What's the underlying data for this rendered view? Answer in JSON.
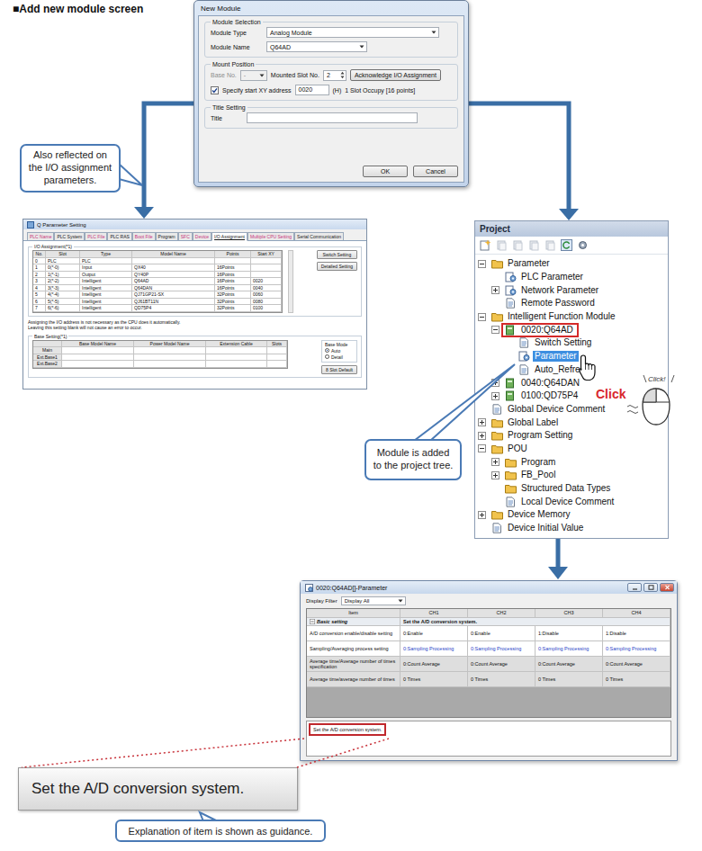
{
  "heading": "■Add new module screen",
  "new_module": {
    "title": "New Module",
    "module_selection": {
      "legend": "Module Selection",
      "fields": [
        {
          "label": "Module Type",
          "value": "Analog Module"
        },
        {
          "label": "Module Name",
          "value": "Q64AD"
        }
      ]
    },
    "mount_position": {
      "legend": "Mount Position",
      "base_no": {
        "label": "Base No.",
        "value": "-",
        "disabled": true
      },
      "slot": {
        "label": "Mounted Slot No.",
        "value": "2"
      },
      "ack_button": "Acknowledge I/O Assignment",
      "start_xy": {
        "label": "Specify start XY address",
        "checked": true,
        "value": "0020",
        "unit": "(H)",
        "occupy": "1 Slot Occupy [16 points]"
      }
    },
    "title_setting": {
      "legend": "Title Setting",
      "label": "Title",
      "value": ""
    },
    "buttons": [
      "OK",
      "Cancel"
    ]
  },
  "callouts": {
    "io": "Also reflected on the I/O assignment parameters.",
    "tree": "Module is added to the project tree.",
    "guidance": "Explanation of item is shown as guidance."
  },
  "param_setting": {
    "title": "Q Parameter Setting",
    "tabs": [
      {
        "label": "PLC Name",
        "selected": false,
        "color": "#c8357c"
      },
      {
        "label": "PLC System",
        "selected": false,
        "color": "#1a1a1a"
      },
      {
        "label": "PLC File",
        "selected": false,
        "color": "#c8357c"
      },
      {
        "label": "PLC RAS",
        "selected": false,
        "color": "#1a1a1a"
      },
      {
        "label": "Boot File",
        "selected": false,
        "color": "#c8357c"
      },
      {
        "label": "Program",
        "selected": false,
        "color": "#1a1a1a"
      },
      {
        "label": "SFC",
        "selected": false,
        "color": "#c8357c"
      },
      {
        "label": "Device",
        "selected": false,
        "color": "#c8357c"
      },
      {
        "label": "I/O Assignment",
        "selected": true,
        "color": "#1a1a1a"
      },
      {
        "label": "Multiple CPU Setting",
        "selected": false,
        "color": "#c8357c"
      },
      {
        "label": "Serial Communication",
        "selected": false,
        "color": "#1a1a1a"
      }
    ],
    "io_group": "I/O Assignment(*1)",
    "io_columns": [
      "No.",
      "Slot",
      "Type",
      "Model Name",
      "Points",
      "Start XY"
    ],
    "io_rows": [
      [
        "0",
        "PLC",
        "PLC",
        "",
        "",
        ""
      ],
      [
        "1",
        "0(*-0)",
        "Input",
        "QX40",
        "16Points",
        ""
      ],
      [
        "2",
        "1(*-1)",
        "Output",
        "QY40P",
        "16Points",
        ""
      ],
      [
        "3",
        "2(*-2)",
        "Intelligent",
        "Q64AD",
        "16Points",
        "0020"
      ],
      [
        "4",
        "3(*-3)",
        "Intelligent",
        "Q64DAN",
        "16Points",
        "0040"
      ],
      [
        "5",
        "4(*-4)",
        "Intelligent",
        "QJ71GP21-SX",
        "32Points",
        "0060"
      ],
      [
        "6",
        "5(*-5)",
        "Intelligent",
        "QJ61BT11N",
        "32Points",
        "0080"
      ],
      [
        "7",
        "6(*-6)",
        "Intelligent",
        "QD75P4",
        "32Points",
        "0100"
      ]
    ],
    "side_buttons": [
      "Switch Setting",
      "Detailed Setting"
    ],
    "notes": [
      "Assigning the I/O address is not necessary as the CPU does it automatically.",
      "Leaving this setting blank will not cause an error to occur."
    ],
    "base_group": "Base Setting(*1)",
    "base_columns": [
      "",
      "Base Model Name",
      "Power Model Name",
      "Extension Cable",
      "Slots"
    ],
    "base_rows": [
      "Main",
      "Ext.Base1",
      "Ext.Base2"
    ],
    "base_mode": {
      "label": "Base Mode",
      "options": [
        {
          "label": "Auto",
          "selected": true
        },
        {
          "label": "Detail",
          "selected": false
        }
      ]
    },
    "default_button": "8 Slot Default"
  },
  "project": {
    "title": "Project",
    "click_label": "Click",
    "mouse_label": "Click!",
    "tree": [
      {
        "label": "Parameter",
        "kind": "folder",
        "has_children": true,
        "expanded": true,
        "selected": false,
        "boxed": false,
        "children": [
          {
            "label": "PLC Parameter",
            "kind": "param",
            "has_children": false,
            "expanded": false,
            "selected": false,
            "boxed": false,
            "children": []
          },
          {
            "label": "Network Parameter",
            "kind": "param",
            "has_children": true,
            "expanded": false,
            "selected": false,
            "boxed": false,
            "children": []
          },
          {
            "label": "Remote Password",
            "kind": "doc",
            "has_children": false,
            "expanded": false,
            "selected": false,
            "boxed": false,
            "children": []
          }
        ]
      },
      {
        "label": "Intelligent Function Module",
        "kind": "folder",
        "has_children": true,
        "expanded": true,
        "selected": false,
        "boxed": false,
        "children": [
          {
            "label": "0020:Q64AD",
            "kind": "module",
            "has_children": true,
            "expanded": true,
            "selected": false,
            "boxed": true,
            "children": [
              {
                "label": "Switch Setting",
                "kind": "doc",
                "has_children": false,
                "expanded": false,
                "selected": false,
                "boxed": false,
                "children": []
              },
              {
                "label": "Parameter",
                "kind": "param",
                "has_children": false,
                "expanded": false,
                "selected": true,
                "boxed": false,
                "children": []
              },
              {
                "label": "Auto_Refre",
                "kind": "doc",
                "has_children": false,
                "expanded": false,
                "selected": false,
                "boxed": false,
                "children": []
              }
            ]
          },
          {
            "label": "0040:Q64DAN",
            "kind": "module",
            "has_children": true,
            "expanded": false,
            "selected": false,
            "boxed": false,
            "children": []
          },
          {
            "label": "0100:QD75P4",
            "kind": "module",
            "has_children": true,
            "expanded": false,
            "selected": false,
            "boxed": false,
            "children": []
          }
        ]
      },
      {
        "label": "Global Device Comment",
        "kind": "doc",
        "has_children": false,
        "expanded": false,
        "selected": false,
        "boxed": false,
        "children": []
      },
      {
        "label": "Global Label",
        "kind": "folder",
        "has_children": true,
        "expanded": false,
        "selected": false,
        "boxed": false,
        "children": []
      },
      {
        "label": "Program Setting",
        "kind": "folder",
        "has_children": true,
        "expanded": false,
        "selected": false,
        "boxed": false,
        "children": []
      },
      {
        "label": "POU",
        "kind": "folder",
        "has_children": true,
        "expanded": true,
        "selected": false,
        "boxed": false,
        "children": [
          {
            "label": "Program",
            "kind": "folder",
            "has_children": true,
            "expanded": false,
            "selected": false,
            "boxed": false,
            "children": []
          },
          {
            "label": "FB_Pool",
            "kind": "folder",
            "has_children": true,
            "expanded": false,
            "selected": false,
            "boxed": false,
            "children": []
          },
          {
            "label": "Structured Data Types",
            "kind": "folder",
            "has_children": false,
            "expanded": false,
            "selected": false,
            "boxed": false,
            "children": []
          },
          {
            "label": "Local Device Comment",
            "kind": "doc",
            "has_children": false,
            "expanded": false,
            "selected": false,
            "boxed": false,
            "children": []
          }
        ]
      },
      {
        "label": "Device Memory",
        "kind": "folder",
        "has_children": true,
        "expanded": false,
        "selected": false,
        "boxed": false,
        "children": []
      },
      {
        "label": "Device Initial Value",
        "kind": "doc",
        "has_children": false,
        "expanded": false,
        "selected": false,
        "boxed": false,
        "children": []
      }
    ]
  },
  "ad_parameter": {
    "title": "0020:Q64AD[]-Parameter",
    "filter": {
      "label": "Display Filter",
      "value": "Display All"
    },
    "columns": [
      "Item",
      "CH1",
      "CH2",
      "CH3",
      "CH4"
    ],
    "group": {
      "label": "Basic setting",
      "description": "Set the A/D conversion system.",
      "expanded": true
    },
    "rows": [
      {
        "item": "A/D conversion enable/disable setting",
        "values": [
          "0:Enable",
          "0:Enable",
          "1:Disable",
          "1:Disable"
        ],
        "color": "#111111",
        "disabled": false
      },
      {
        "item": "Sampling/Averaging process setting",
        "values": [
          "0:Sampling Processing",
          "0:Sampling Processing",
          "0:Sampling Processing",
          "0:Sampling Processing"
        ],
        "color": "#1f45c8",
        "disabled": false
      },
      {
        "item": "Average time/Average number of times specification",
        "values": [
          "0:Count Average",
          "0:Count Average",
          "0:Count Average",
          "0:Count Average"
        ],
        "color": "#111111",
        "disabled": true
      },
      {
        "item": "Average time/average number of times",
        "values": [
          "0 Times",
          "0 Times",
          "0 Times",
          "0 Times"
        ],
        "color": "#111111",
        "disabled": true
      }
    ],
    "explanation": {
      "text": "Set the A/D conversion system.",
      "highlighted": true
    }
  },
  "guidance": {
    "text": "Set the A/D conversion system."
  }
}
